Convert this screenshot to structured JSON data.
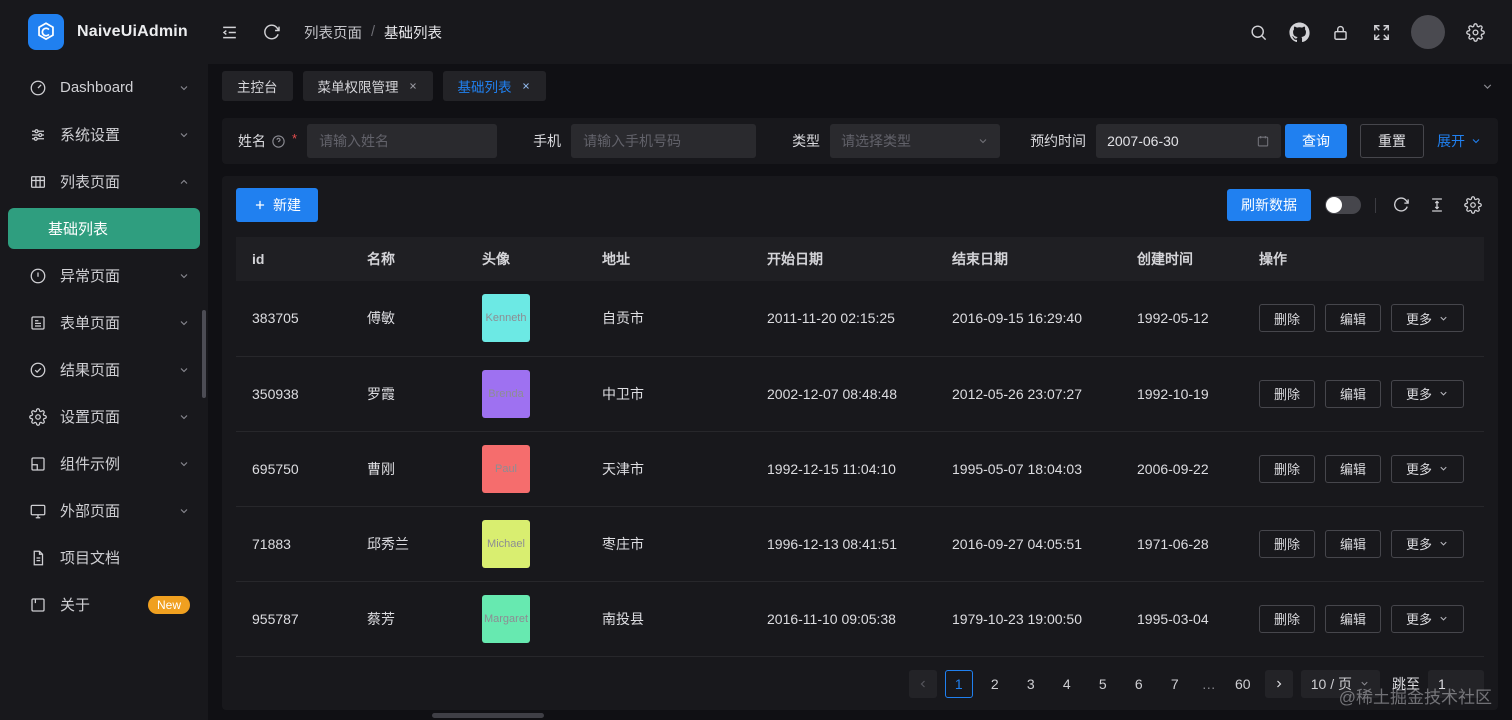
{
  "colors": {
    "accent_blue": "#2080f0",
    "active_green": "#2f9e7f",
    "badge_orange": "#f0a020"
  },
  "header": {
    "app_title": "NaiveUiAdmin",
    "breadcrumb": {
      "parent": "列表页面",
      "separator": "/",
      "current": "基础列表"
    }
  },
  "sidebar": {
    "items": [
      {
        "label": "Dashboard"
      },
      {
        "label": "系统设置"
      },
      {
        "label": "列表页面"
      },
      {
        "label": "基础列表"
      },
      {
        "label": "异常页面"
      },
      {
        "label": "表单页面"
      },
      {
        "label": "结果页面"
      },
      {
        "label": "设置页面"
      },
      {
        "label": "组件示例"
      },
      {
        "label": "外部页面"
      },
      {
        "label": "项目文档"
      },
      {
        "label": "关于",
        "badge": "New"
      }
    ]
  },
  "tabs": {
    "items": [
      {
        "label": "主控台"
      },
      {
        "label": "菜单权限管理"
      },
      {
        "label": "基础列表"
      }
    ]
  },
  "filters": {
    "name_label": "姓名",
    "name_placeholder": "请输入姓名",
    "phone_label": "手机",
    "phone_placeholder": "请输入手机号码",
    "type_label": "类型",
    "type_placeholder": "请选择类型",
    "date_label": "预约时间",
    "date_value": "2007-06-30",
    "query_button": "查询",
    "reset_button": "重置",
    "expand_button": "展开"
  },
  "toolbar": {
    "create_button": "新建",
    "refresh_button": "刷新数据"
  },
  "table": {
    "columns": [
      "id",
      "名称",
      "头像",
      "地址",
      "开始日期",
      "结束日期",
      "创建时间",
      "操作"
    ],
    "action_labels": {
      "delete": "删除",
      "edit": "编辑",
      "more": "更多"
    },
    "rows": [
      {
        "id": "383705",
        "name": "傅敏",
        "avatar_text": "Kenneth",
        "avatar_color": "#6ce9e4",
        "address": "自贡市",
        "begin_date": "2011-11-20 02:15:25",
        "end_date": "2016-09-15 16:29:40",
        "create_date": "1992-05-12"
      },
      {
        "id": "350938",
        "name": "罗霞",
        "avatar_text": "Brenda",
        "avatar_color": "#9e71f1",
        "address": "中卫市",
        "begin_date": "2002-12-07 08:48:48",
        "end_date": "2012-05-26 23:07:27",
        "create_date": "1992-10-19"
      },
      {
        "id": "695750",
        "name": "曹刚",
        "avatar_text": "Paul",
        "avatar_color": "#f56d6d",
        "address": "天津市",
        "begin_date": "1992-12-15 11:04:10",
        "end_date": "1995-05-07 18:04:03",
        "create_date": "2006-09-22"
      },
      {
        "id": "71883",
        "name": "邱秀兰",
        "avatar_text": "Michael",
        "avatar_color": "#d9ee70",
        "address": "枣庄市",
        "begin_date": "1996-12-13 08:41:51",
        "end_date": "2016-09-27 04:05:51",
        "create_date": "1971-06-28"
      },
      {
        "id": "955787",
        "name": "蔡芳",
        "avatar_text": "Margaret",
        "avatar_color": "#67e9b0",
        "address": "南投县",
        "begin_date": "2016-11-10 09:05:38",
        "end_date": "1979-10-23 19:00:50",
        "create_date": "1995-03-04"
      }
    ]
  },
  "pagination": {
    "pages": [
      "1",
      "2",
      "3",
      "4",
      "5",
      "6",
      "7",
      "…",
      "60"
    ],
    "page_size": "10 / 页",
    "jump_label": "跳至",
    "jump_value": "1"
  },
  "watermark": "@稀土掘金技术社区"
}
